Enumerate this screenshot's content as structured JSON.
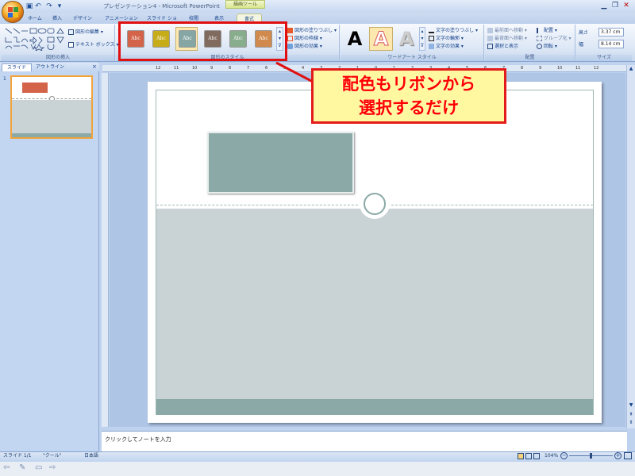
{
  "window": {
    "title": "プレゼンテーション4 - Microsoft PowerPoint",
    "contextual_tool": "描画ツール"
  },
  "tabs": [
    "ホーム",
    "挿入",
    "デザイン",
    "アニメーション",
    "スライド ショー",
    "校閲",
    "表示",
    "書式"
  ],
  "active_tab": "書式",
  "ribbon": {
    "insert_shapes": {
      "label": "図形の挿入",
      "edit_shape": "図形の編集",
      "text_box": "テキスト ボックス"
    },
    "shape_styles": {
      "label": "図形のスタイル",
      "swatch_text": "Abc",
      "swatches": [
        {
          "color": "#d3644a"
        },
        {
          "color": "#c7ac1a"
        },
        {
          "color": "#86a6a4"
        },
        {
          "color": "#806b5e"
        },
        {
          "color": "#88ad8d"
        },
        {
          "color": "#d08a4d"
        }
      ],
      "fill": "図形の塗りつぶし",
      "outline": "図形の枠線",
      "effects": "図形の効果"
    },
    "wordart": {
      "label": "ワードアート スタイル",
      "letter": "A",
      "text_fill": "文字の塗りつぶし",
      "text_outline": "文字の輪郭",
      "text_effects": "文字の効果"
    },
    "arrange": {
      "label": "配置",
      "bring_front": "最前面へ移動",
      "send_back": "最背面へ移動",
      "selection": "選択と表示",
      "align": "配置",
      "group": "グループ化",
      "rotate": "回転"
    },
    "size": {
      "label": "サイズ",
      "height_label": "高さ",
      "height_value": "3.37 cm",
      "width_label": "幅",
      "width_value": "8.14 cm"
    }
  },
  "callout": {
    "line1": "配色もリボンから",
    "line2": "選択するだけ"
  },
  "left_panel": {
    "tabs": [
      "スライド",
      "アウトライン"
    ],
    "slide_number": "1"
  },
  "ruler_labels": [
    "12",
    "11",
    "10",
    "9",
    "8",
    "7",
    "6",
    "5",
    "4",
    "3",
    "2",
    "1",
    "0",
    "1",
    "2",
    "3",
    "4",
    "5",
    "6",
    "7",
    "8",
    "9",
    "10",
    "11",
    "12"
  ],
  "notes_placeholder": "クリックしてノートを入力",
  "status": {
    "slide": "スライド 1/1",
    "theme": "\"クール\"",
    "language": "日本語",
    "zoom": "104%"
  },
  "colors": {
    "slide_gray": "#c9d3d6",
    "shape_fill": "#8ba9a7",
    "footer_bar": "#8ba9a7",
    "accent_red": "#e01010",
    "callout_bg": "#fff8a0"
  }
}
